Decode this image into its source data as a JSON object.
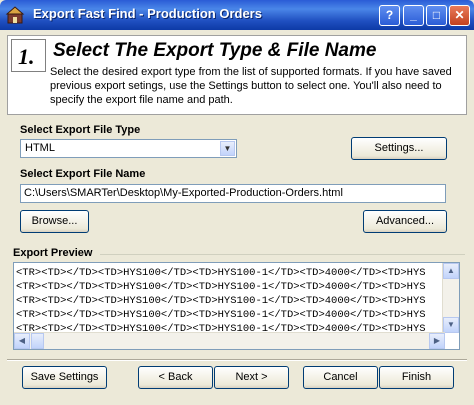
{
  "window": {
    "title": "Export Fast Find - Production Orders",
    "controls": [
      "?",
      "_",
      "□",
      "✕"
    ]
  },
  "header": {
    "step_number": "1.",
    "title": "Select The Export Type & File Name",
    "description": "Select the desired export type from the list of supported formats.  If you have saved previous export setings, use the Settings button to select one.  You'll also need to specify the export file name and path."
  },
  "export_type": {
    "label": "Select Export File Type",
    "selected": "HTML",
    "settings_button": "Settings..."
  },
  "export_file": {
    "label": "Select Export File Name",
    "value": "C:\\Users\\SMARTer\\Desktop\\My-Exported-Production-Orders.html",
    "browse_button": "Browse...",
    "advanced_button": "Advanced..."
  },
  "preview": {
    "label": "Export Preview",
    "lines": [
      "<TR><TD></TD><TD>HYS100</TD><TD>HYS100-1</TD><TD>4000</TD><TD>HYS",
      "<TR><TD></TD><TD>HYS100</TD><TD>HYS100-1</TD><TD>4000</TD><TD>HYS",
      "<TR><TD></TD><TD>HYS100</TD><TD>HYS100-1</TD><TD>4000</TD><TD>HYS",
      "<TR><TD></TD><TD>HYS100</TD><TD>HYS100-1</TD><TD>4000</TD><TD>HYS",
      "<TR><TD></TD><TD>HYS100</TD><TD>HYS100-1</TD><TD>4000</TD><TD>HYS"
    ]
  },
  "buttons": {
    "save_settings": "Save Settings",
    "back": "< Back",
    "next": "Next >",
    "cancel": "Cancel",
    "finish": "Finish"
  },
  "colors": {
    "title_bar": "#2a5cd6",
    "dialog_bg": "#ece9d8",
    "button_border": "#003c74"
  },
  "icons": [
    "app-icon",
    "help-icon",
    "minimize-icon",
    "maximize-icon",
    "close-icon",
    "dropdown-arrow-icon",
    "scroll-up-icon",
    "scroll-down-icon",
    "scroll-left-icon",
    "scroll-right-icon"
  ]
}
